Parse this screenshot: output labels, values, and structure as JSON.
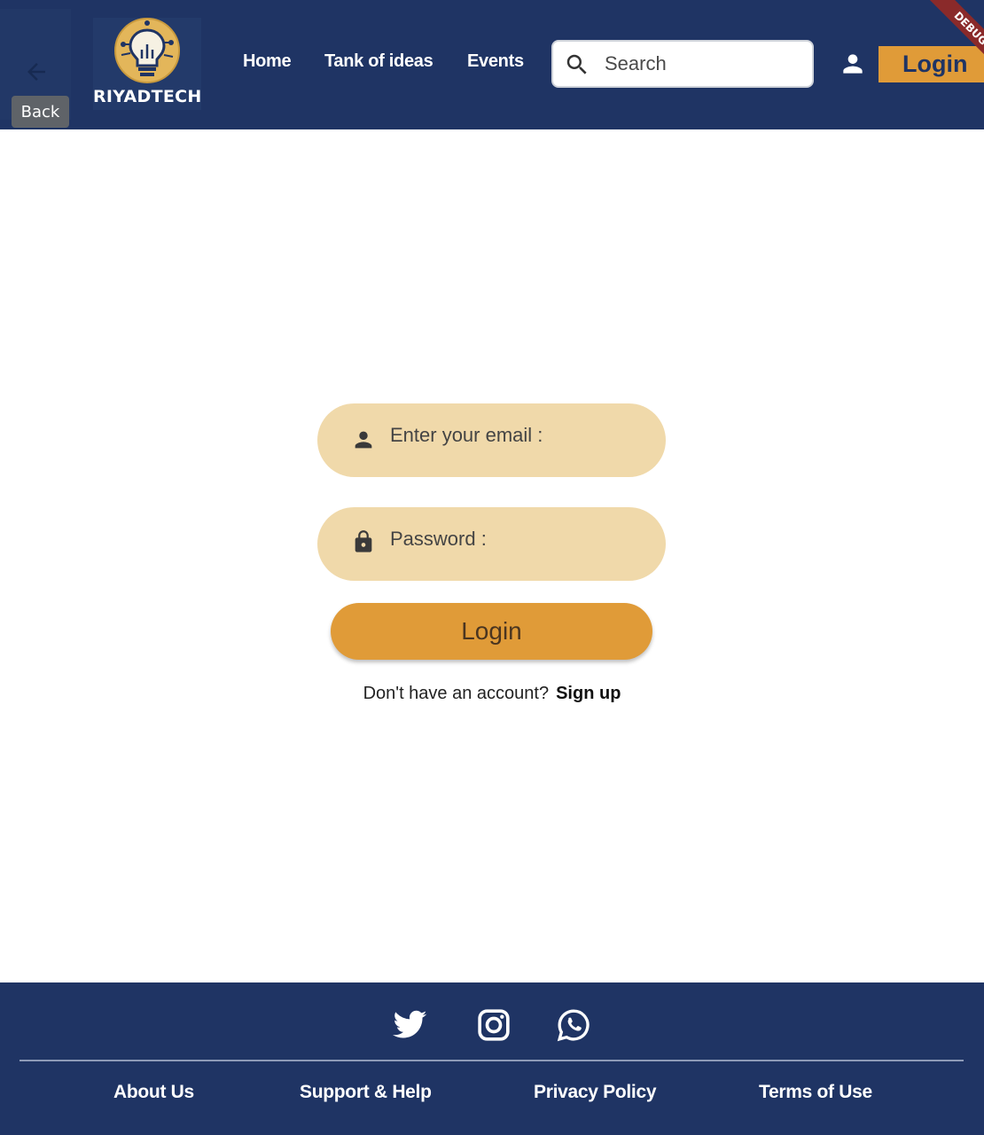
{
  "header": {
    "back_tooltip": "Back",
    "logo_text": "RIYADTECH",
    "nav": {
      "home": "Home",
      "tank": "Tank of ideas",
      "events": "Events"
    },
    "search": {
      "placeholder": "Search"
    },
    "login_label": "Login",
    "debug_banner": "DEBUG"
  },
  "form": {
    "email_placeholder": "Enter your email :",
    "password_placeholder": "Password :",
    "login_button": "Login",
    "no_account_text": "Don't have an account?",
    "signup_link": "Sign up"
  },
  "footer": {
    "social_icons": [
      "twitter-icon",
      "instagram-icon",
      "whatsapp-icon"
    ],
    "links": {
      "about": "About Us",
      "support": "Support & Help",
      "privacy": "Privacy Policy",
      "terms": "Terms of Use"
    }
  },
  "colors": {
    "header_bg": "#1f3464",
    "accent": "#e09b38",
    "field_bg": "#f0d9aa",
    "debug_ribbon": "#8a2a2a"
  }
}
